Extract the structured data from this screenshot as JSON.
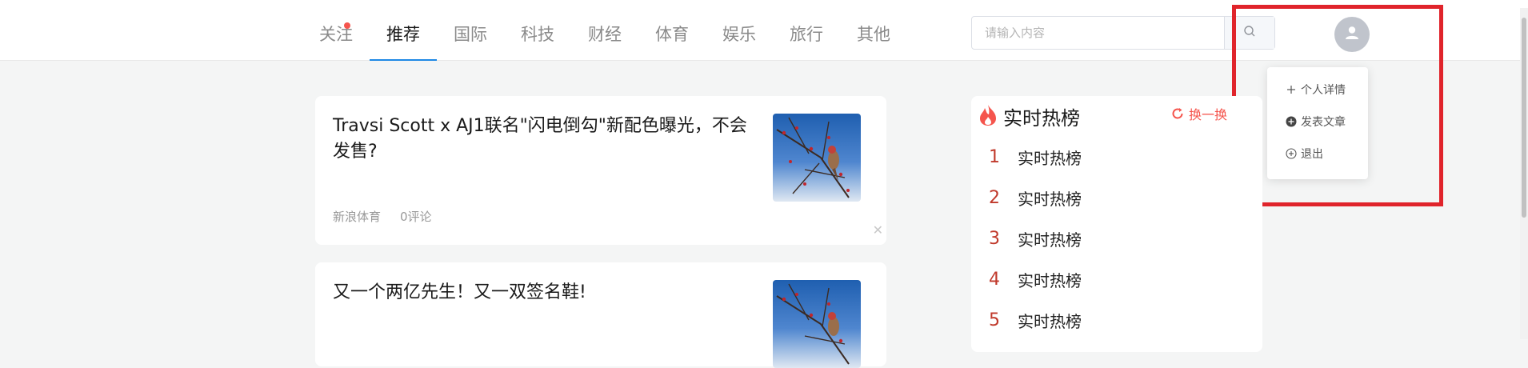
{
  "nav": {
    "items": [
      {
        "label": "关注",
        "active": false,
        "dot": true
      },
      {
        "label": "推荐",
        "active": true
      },
      {
        "label": "国际",
        "active": false
      },
      {
        "label": "科技",
        "active": false
      },
      {
        "label": "财经",
        "active": false
      },
      {
        "label": "体育",
        "active": false
      },
      {
        "label": "娱乐",
        "active": false
      },
      {
        "label": "旅行",
        "active": false
      },
      {
        "label": "其他",
        "active": false
      }
    ]
  },
  "search": {
    "placeholder": "请输入内容",
    "value": "",
    "icon": "search-icon"
  },
  "user_menu": {
    "avatar_icon": "user-icon",
    "items": [
      {
        "label": "个人详情",
        "icon": "plus-icon"
      },
      {
        "label": "发表文章",
        "icon": "plus-circle-filled-icon"
      },
      {
        "label": "退出",
        "icon": "plus-circle-icon"
      }
    ]
  },
  "articles": [
    {
      "title": "Travsi Scott x AJ1联名\"闪电倒勾\"新配色曝光，不会发售?",
      "source": "新浪体育",
      "comments": "0评论",
      "image": "bird-on-branch"
    },
    {
      "title": "又一个两亿先生！又一双签名鞋!",
      "image": "bird-on-branch"
    }
  ],
  "hot_list": {
    "title": "实时热榜",
    "refresh_label": "换一换",
    "items": [
      {
        "rank": "1",
        "text": "实时热榜"
      },
      {
        "rank": "2",
        "text": "实时热榜"
      },
      {
        "rank": "3",
        "text": "实时热榜"
      },
      {
        "rank": "4",
        "text": "实时热榜"
      },
      {
        "rank": "5",
        "text": "实时热榜"
      }
    ]
  },
  "colors": {
    "accent": "#1e88e5",
    "hot": "#f5554d",
    "annotation": "#e0242b"
  }
}
